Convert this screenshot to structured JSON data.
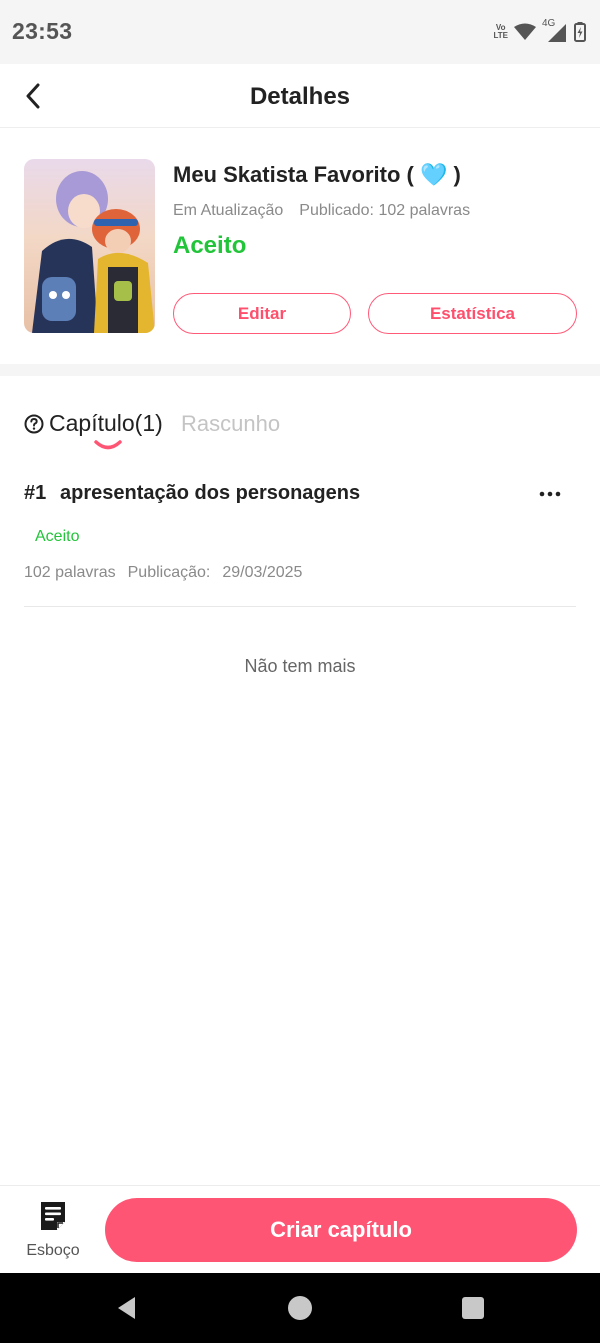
{
  "status_bar": {
    "time": "23:53",
    "volte_line1": "Vo",
    "volte_line2": "LTE",
    "network": "4G",
    "icons": [
      "volte-icon",
      "wifi-icon",
      "signal-icon",
      "battery-charging-icon"
    ]
  },
  "header": {
    "title": "Detalhes",
    "back_icon": "chevron-left-icon"
  },
  "book": {
    "title": "Meu Skatista Favorito ( 🩵 )",
    "update_status": "Em Atualização",
    "published": "Publicado: 102 palavras",
    "review_status": "Aceito",
    "review_status_color": "#22c43a",
    "edit_label": "Editar",
    "stats_label": "Estatística"
  },
  "tabs": {
    "chapters_label": "Capítulo(1)",
    "drafts_label": "Rascunho",
    "help_icon": "help-circle-icon"
  },
  "chapters": [
    {
      "number": "#1",
      "title": "apresentação dos personagens",
      "status": "Aceito",
      "words": "102 palavras",
      "pub_label": "Publicação:",
      "pub_date": "29/03/2025"
    }
  ],
  "list_end": "Não tem mais",
  "bottom_bar": {
    "draft_label": "Esboço",
    "create_label": "Criar capítulo"
  },
  "colors": {
    "accent": "#ff5574",
    "accent_outline": "#ff5a78",
    "success": "#22c43a"
  }
}
